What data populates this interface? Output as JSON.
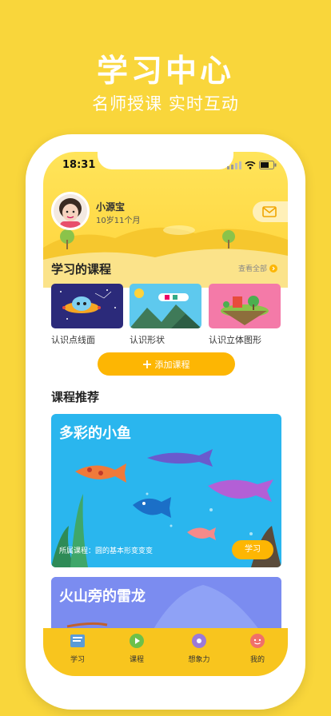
{
  "hero": {
    "title": "学习中心",
    "subtitle": "名师授课 实时互动"
  },
  "status": {
    "time": "18:31"
  },
  "profile": {
    "name": "小源宝",
    "age": "10岁11个月"
  },
  "my_courses": {
    "title": "学习的课程",
    "see_all": "查看全部",
    "items": [
      {
        "label": "认识点线面",
        "icon": "space-ufo-thumbnail"
      },
      {
        "label": "认识形状",
        "icon": "mountain-plane-thumbnail"
      },
      {
        "label": "认识立体图形",
        "icon": "floating-island-thumbnail"
      }
    ],
    "add_label": "添加课程"
  },
  "recommend": {
    "title": "课程推荐",
    "cards": [
      {
        "title": "多彩的小鱼",
        "meta_prefix": "所属课程：",
        "meta_value": "圆的基本形变变变",
        "button": "学习"
      },
      {
        "title": "火山旁的雷龙"
      }
    ]
  },
  "tabs": [
    {
      "label": "学习",
      "icon": "book-icon",
      "active": true
    },
    {
      "label": "课程",
      "icon": "play-icon",
      "active": false
    },
    {
      "label": "想象力",
      "icon": "disc-icon",
      "active": false
    },
    {
      "label": "我的",
      "icon": "face-icon",
      "active": false
    }
  ],
  "colors": {
    "background": "#f9d63b",
    "accent": "#fdb603",
    "tabbar": "#f8c51e",
    "ocean": "#2ab6ee"
  }
}
